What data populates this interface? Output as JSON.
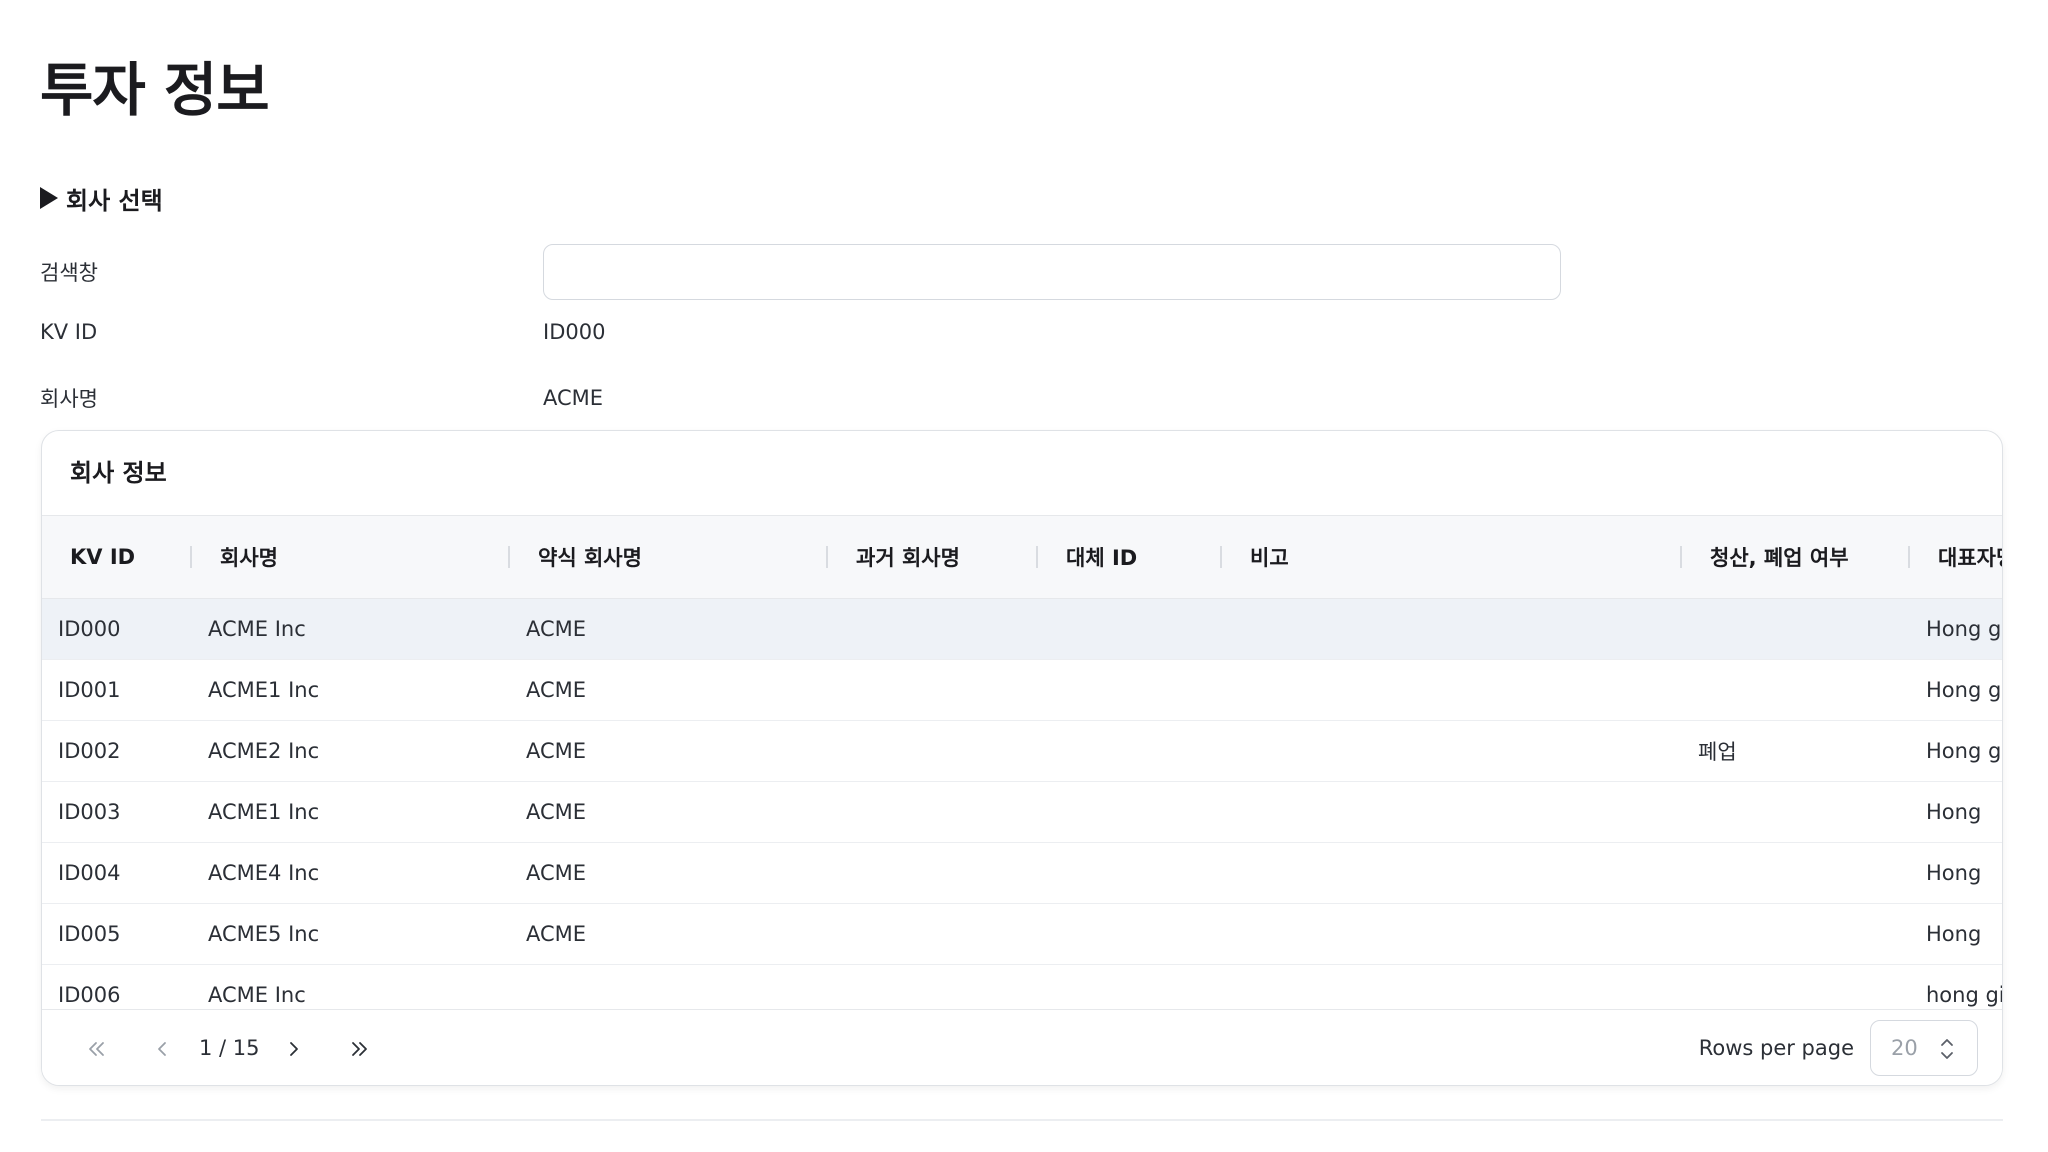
{
  "page": {
    "title": "투자 정보"
  },
  "company_select": {
    "toggle_label": "회사 선택",
    "search_label": "검색창",
    "search_value": "",
    "kv_id_label": "KV ID",
    "kv_id_value": "ID000",
    "name_label": "회사명",
    "name_value": "ACME"
  },
  "company_info": {
    "title": "회사 정보",
    "columns": [
      "KV ID",
      "회사명",
      "약식 회사명",
      "과거 회사명",
      "대체 ID",
      "비고",
      "청산, 폐업 여부",
      "대표자명"
    ],
    "rows": [
      [
        "ID000",
        "ACME Inc",
        "ACME",
        "",
        "",
        "",
        "",
        "Hong gil"
      ],
      [
        "ID001",
        "ACME1 Inc",
        "ACME",
        "",
        "",
        "",
        "",
        "Hong gil"
      ],
      [
        "ID002",
        "ACME2 Inc",
        "ACME",
        "",
        "",
        "",
        "폐업",
        "Hong gil"
      ],
      [
        "ID003",
        "ACME1 Inc",
        "ACME",
        "",
        "",
        "",
        "",
        "Hong"
      ],
      [
        "ID004",
        "ACME4 Inc",
        "ACME",
        "",
        "",
        "",
        "",
        "Hong"
      ],
      [
        "ID005",
        "ACME5 Inc",
        "ACME",
        "",
        "",
        "",
        "",
        "Hong"
      ],
      [
        "ID006",
        "ACME Inc",
        "",
        "",
        "",
        "",
        "",
        "hong gil"
      ]
    ],
    "selected_row": 0
  },
  "pagination": {
    "page_text": "1 / 15",
    "rows_per_page_label": "Rows per page",
    "rows_per_page_value": "20"
  },
  "icons": {
    "first": "chevrons-left-icon",
    "prev": "chevron-left-icon",
    "next": "chevron-right-icon",
    "last": "chevrons-right-icon",
    "stepper": "chevron-up-down-icon"
  },
  "colors": {
    "selected_row_bg": "#eef2f7",
    "header_bg": "#f7f8fa",
    "border": "#dfe2e6"
  }
}
